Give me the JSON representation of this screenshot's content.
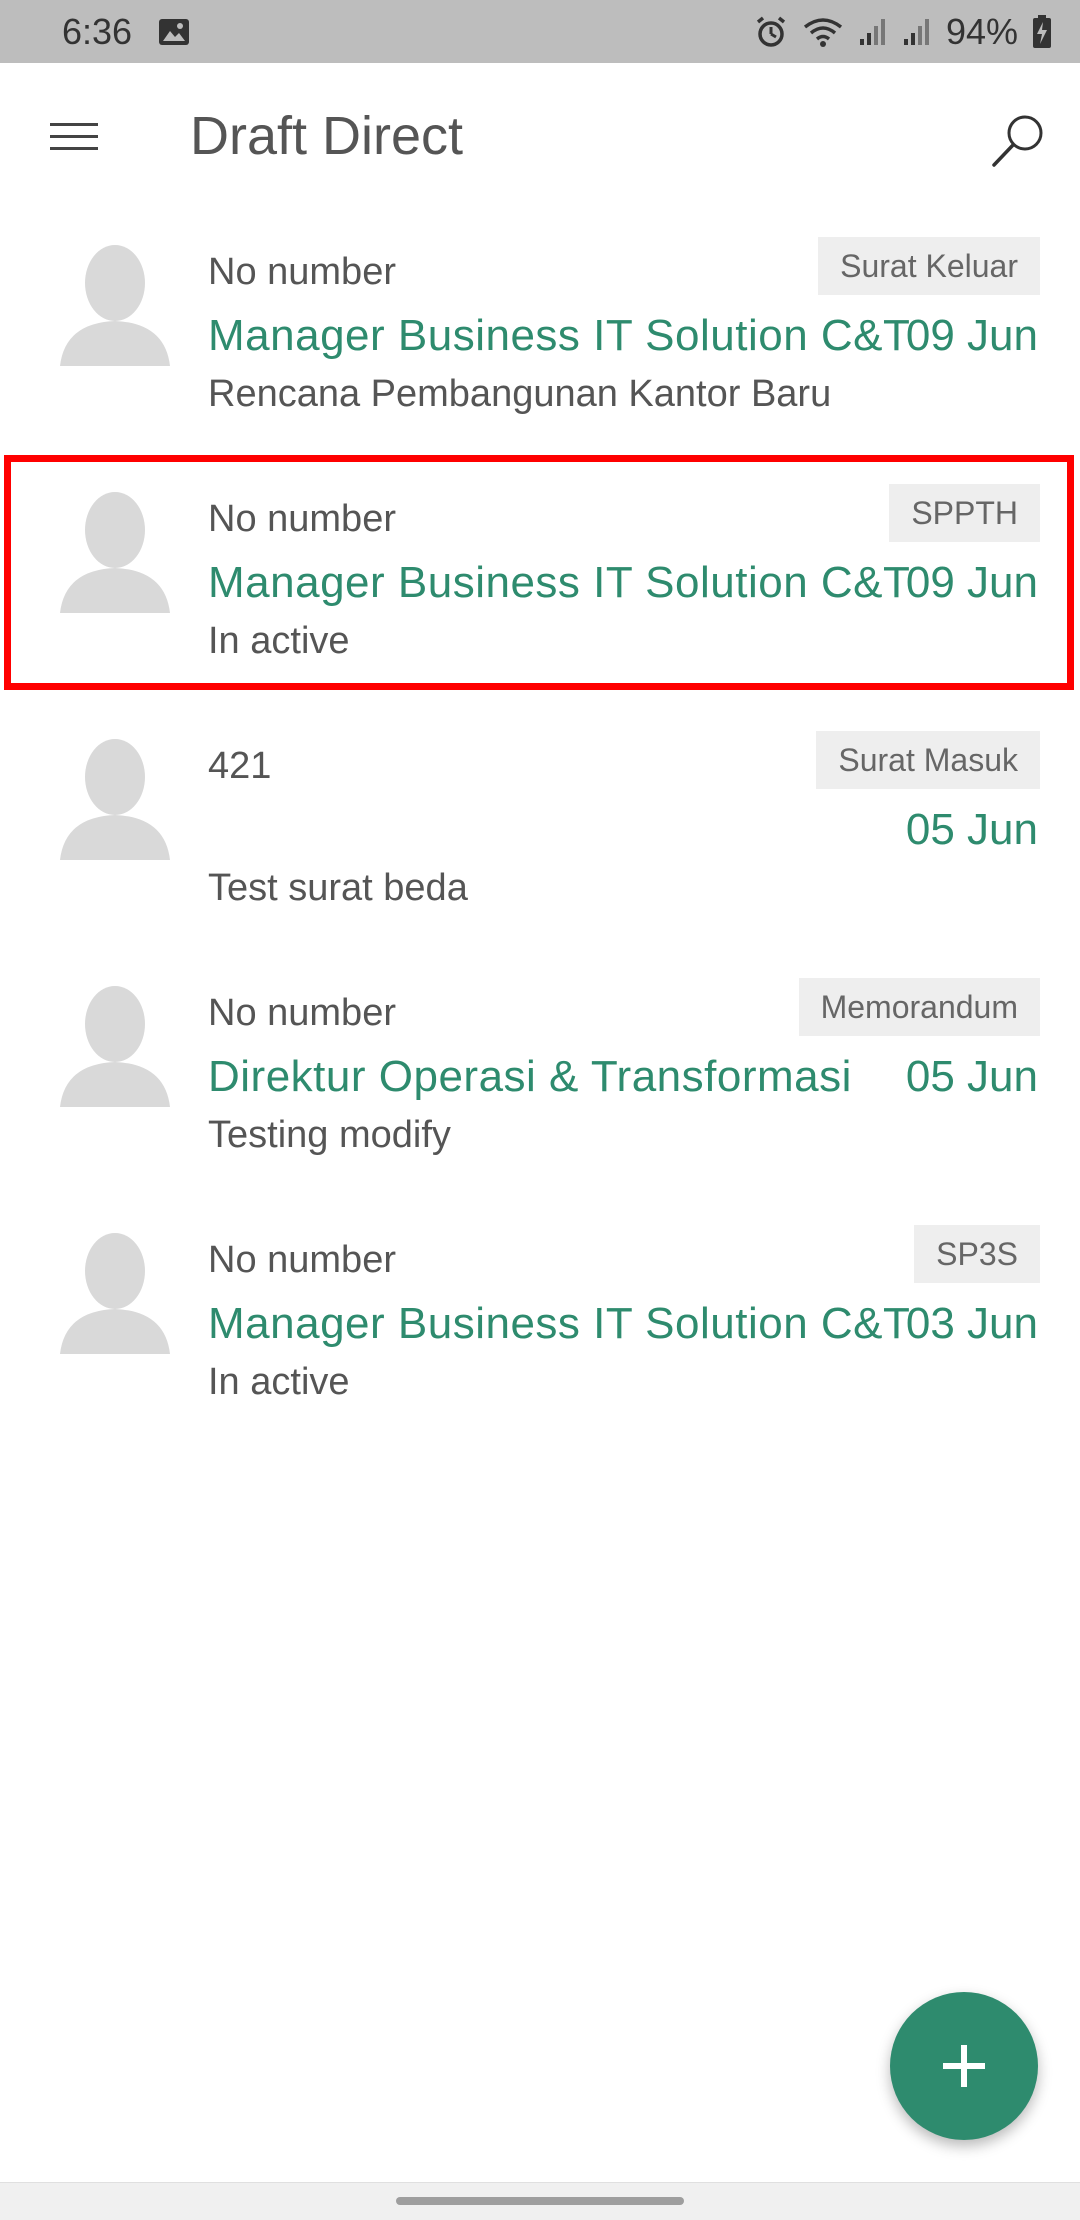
{
  "status_bar": {
    "time": "6:36",
    "battery_percent": "94%",
    "icons": [
      "image-icon",
      "alarm-icon",
      "wifi-icon",
      "signal-icon",
      "signal-icon",
      "battery-charging-icon"
    ]
  },
  "app_bar": {
    "title": "Draft Direct",
    "menu_icon": "hamburger-menu-icon",
    "search_icon": "search-icon"
  },
  "items": [
    {
      "number": "No number",
      "sender": "Manager Business IT Solution C&T",
      "date": "09 Jun",
      "subject": "Rencana Pembangunan Kantor Baru",
      "badge": "Surat Keluar"
    },
    {
      "number": "No number",
      "sender": "Manager Business IT Solution C&T",
      "date": "09 Jun",
      "subject": "In active",
      "badge": "SPPTH",
      "highlighted": true
    },
    {
      "number": "421",
      "sender": "",
      "date": "05 Jun",
      "subject": "Test surat beda",
      "badge": "Surat Masuk"
    },
    {
      "number": "No number",
      "sender": "Direktur Operasi & Transformasi",
      "date": "05 Jun",
      "subject": "Testing modify",
      "badge": "Memorandum"
    },
    {
      "number": "No number",
      "sender": "Manager Business IT Solution C&T",
      "date": "03 Jun",
      "subject": "In active",
      "badge": "SP3S"
    }
  ],
  "fab": {
    "icon": "plus-icon"
  },
  "colors": {
    "accent": "#2e8b6e",
    "status_bar": "#bdbdbd",
    "badge_bg": "#eeeeee",
    "highlight": "#ff0000",
    "avatar": "#d9d9d9"
  }
}
